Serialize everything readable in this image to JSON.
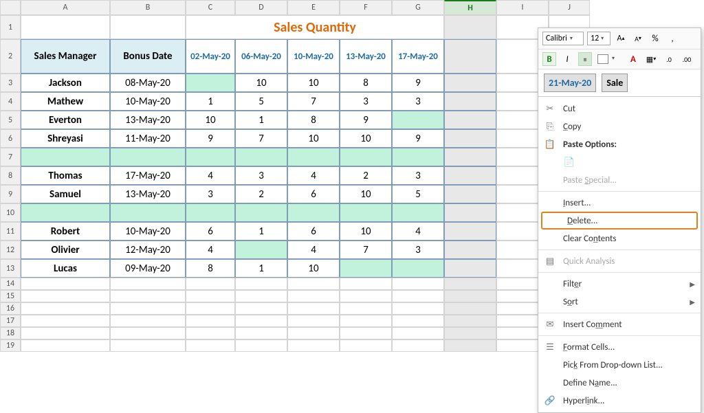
{
  "title": "Sales Quantity",
  "cols": [
    "A",
    "B",
    "C",
    "D",
    "E",
    "F",
    "G",
    "H",
    "I",
    "J"
  ],
  "selCol": "H",
  "rowNums": [
    1,
    2,
    3,
    4,
    5,
    6,
    7,
    8,
    9,
    10,
    11,
    12,
    13,
    14,
    15,
    16,
    17,
    18,
    19
  ],
  "headers": {
    "mgr": "Sales Manager",
    "bonus": "Bonus Date"
  },
  "dateHdrs": [
    "02-May-20",
    "06-May-20",
    "10-May-20",
    "13-May-20",
    "17-May-20"
  ],
  "extraDate": "21-May-20",
  "extraLabel": "Sale",
  "rows": [
    {
      "n": "Jackson",
      "d": "08-May-20",
      "v": [
        "",
        "10",
        "10",
        "8",
        "9"
      ]
    },
    {
      "n": "Mathew",
      "d": "10-May-20",
      "v": [
        "1",
        "5",
        "7",
        "3",
        "3"
      ]
    },
    {
      "n": "Everton",
      "d": "13-May-20",
      "v": [
        "10",
        "1",
        "8",
        "9",
        ""
      ]
    },
    {
      "n": "Shreyasi",
      "d": "11-May-20",
      "v": [
        "9",
        "7",
        "10",
        "10",
        "9"
      ]
    },
    null,
    {
      "n": "Thomas",
      "d": "17-May-20",
      "v": [
        "4",
        "3",
        "4",
        "2",
        "3"
      ]
    },
    {
      "n": "Samuel",
      "d": "13-May-20",
      "v": [
        "3",
        "2",
        "6",
        "10",
        "5"
      ]
    },
    null,
    {
      "n": "Robert",
      "d": "10-May-20",
      "v": [
        "6",
        "1",
        "6",
        "10",
        "4"
      ]
    },
    {
      "n": "Olivier",
      "d": "12-May-20",
      "v": [
        "4",
        "",
        "4",
        "7",
        "3"
      ]
    },
    {
      "n": "Lucas",
      "d": "09-May-20",
      "v": [
        "8",
        "1",
        "10",
        "",
        ""
      ]
    }
  ],
  "toolbar": {
    "font": "Calibri",
    "size": "12",
    "B": "B",
    "I": "I",
    "pct": "%"
  },
  "menu": {
    "cut": "Cut",
    "copy": "Copy",
    "pasteOpt": "Paste Options:",
    "pasteSp": "Paste Special...",
    "insert": "Insert...",
    "delete": "Delete...",
    "clear": "Clear Contents",
    "qa": "Quick Analysis",
    "filter": "Filter",
    "sort": "Sort",
    "comment": "Insert Comment",
    "fmt": "Format Cells...",
    "pick": "Pick From Drop-down List...",
    "name": "Define Name...",
    "link": "Hyperlink..."
  }
}
